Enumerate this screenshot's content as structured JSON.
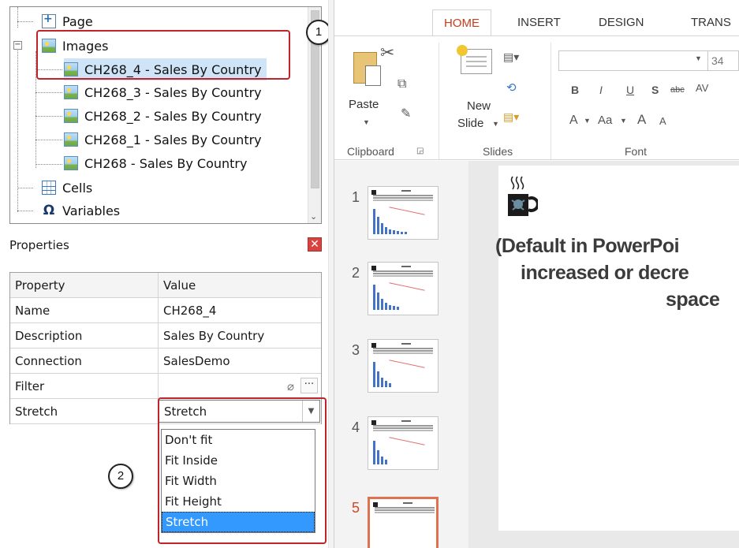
{
  "tree": {
    "items": [
      {
        "label": "Page",
        "icon": "page-icon"
      },
      {
        "label": "Images",
        "icon": "image-icon"
      },
      {
        "label": "CH268_4 - Sales By Country",
        "icon": "image-icon"
      },
      {
        "label": "CH268_3 - Sales By Country",
        "icon": "image-icon"
      },
      {
        "label": "CH268_2 - Sales By Country",
        "icon": "image-icon"
      },
      {
        "label": "CH268_1 - Sales By Country",
        "icon": "image-icon"
      },
      {
        "label": "CH268 - Sales By Country",
        "icon": "image-icon"
      },
      {
        "label": "Cells",
        "icon": "table-icon"
      },
      {
        "label": "Variables",
        "icon": "omega-icon"
      }
    ],
    "omega_glyph": "Ω"
  },
  "callouts": {
    "one": "1",
    "two": "2"
  },
  "properties": {
    "title": "Properties",
    "close_glyph": "✕",
    "headers": {
      "property": "Property",
      "value": "Value"
    },
    "rows": [
      {
        "name": "Name",
        "value": "CH268_4"
      },
      {
        "name": "Description",
        "value": "Sales By Country"
      },
      {
        "name": "Connection",
        "value": "SalesDemo"
      },
      {
        "name": "Filter",
        "value": ""
      },
      {
        "name": "Stretch",
        "value": "Stretch"
      }
    ],
    "dots_label": "···",
    "stretch_options": [
      "Don't fit",
      "Fit Inside",
      "Fit Width",
      "Fit Height",
      "Stretch"
    ],
    "selected_option": "Stretch"
  },
  "ppt": {
    "tabs": [
      "HOME",
      "INSERT",
      "DESIGN",
      "TRANS"
    ],
    "active_tab": "HOME",
    "ribbon": {
      "paste": "Paste",
      "new": "New",
      "slide": "Slide",
      "font_size": "34",
      "bold": "B",
      "italic": "I",
      "underline": "U",
      "shadow": "S",
      "strike": "abc",
      "spacing": "AV",
      "font_color": "A",
      "change_case": "Aa",
      "grow": "A",
      "shrink": "A",
      "groups": {
        "clipboard": "Clipboard",
        "slides": "Slides",
        "font": "Font"
      }
    },
    "slide_numbers": [
      "1",
      "2",
      "3",
      "4",
      "5"
    ],
    "active_slide": "5",
    "slide_text": [
      "(Default in PowerPoi",
      "increased or decre",
      "space"
    ]
  },
  "colors": {
    "accent": "#c43e1c",
    "callout_red": "#c0242b",
    "selection": "#3399ff"
  }
}
